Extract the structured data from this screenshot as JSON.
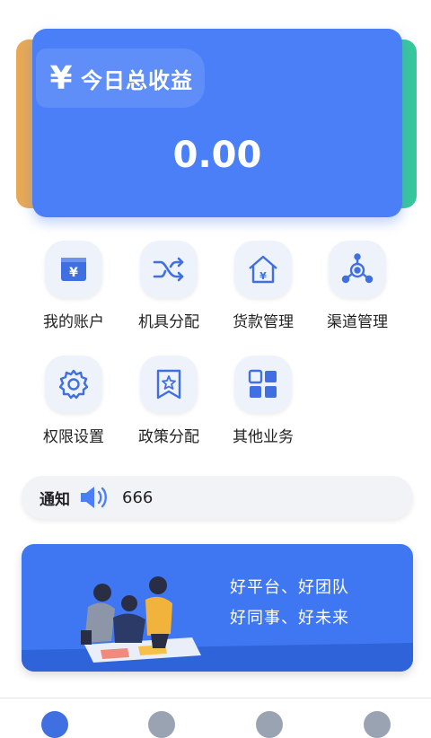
{
  "earnings": {
    "title": "今日总收益",
    "currency_symbol": "¥",
    "value": "0.00",
    "color": "#4A7FF7",
    "side_colors": [
      "#E7A954",
      "#38C79A"
    ]
  },
  "menu": {
    "items": [
      {
        "label": "我的账户",
        "icon": "wallet-icon"
      },
      {
        "label": "机具分配",
        "icon": "shuffle-icon"
      },
      {
        "label": "货款管理",
        "icon": "house-yen-icon"
      },
      {
        "label": "渠道管理",
        "icon": "channel-network-icon"
      },
      {
        "label": "权限设置",
        "icon": "gear-icon"
      },
      {
        "label": "政策分配",
        "icon": "bookmark-star-icon"
      },
      {
        "label": "其他业务",
        "icon": "grid-icon"
      }
    ]
  },
  "notice": {
    "label": "通知",
    "icon": "speaker-icon",
    "text": "666"
  },
  "banner": {
    "line1": "好平台、好团队",
    "line2": "好同事、好未来",
    "illustration": "team-illustration"
  },
  "bottom_nav": {
    "items": [
      {
        "icon": "home-icon",
        "active": true
      },
      {
        "icon": "nav-icon-2",
        "active": false
      },
      {
        "icon": "nav-icon-3",
        "active": false
      },
      {
        "icon": "profile-icon",
        "active": false
      }
    ]
  },
  "colors": {
    "accent": "#4A7FF7",
    "icon_blue": "#3F6FE0"
  }
}
